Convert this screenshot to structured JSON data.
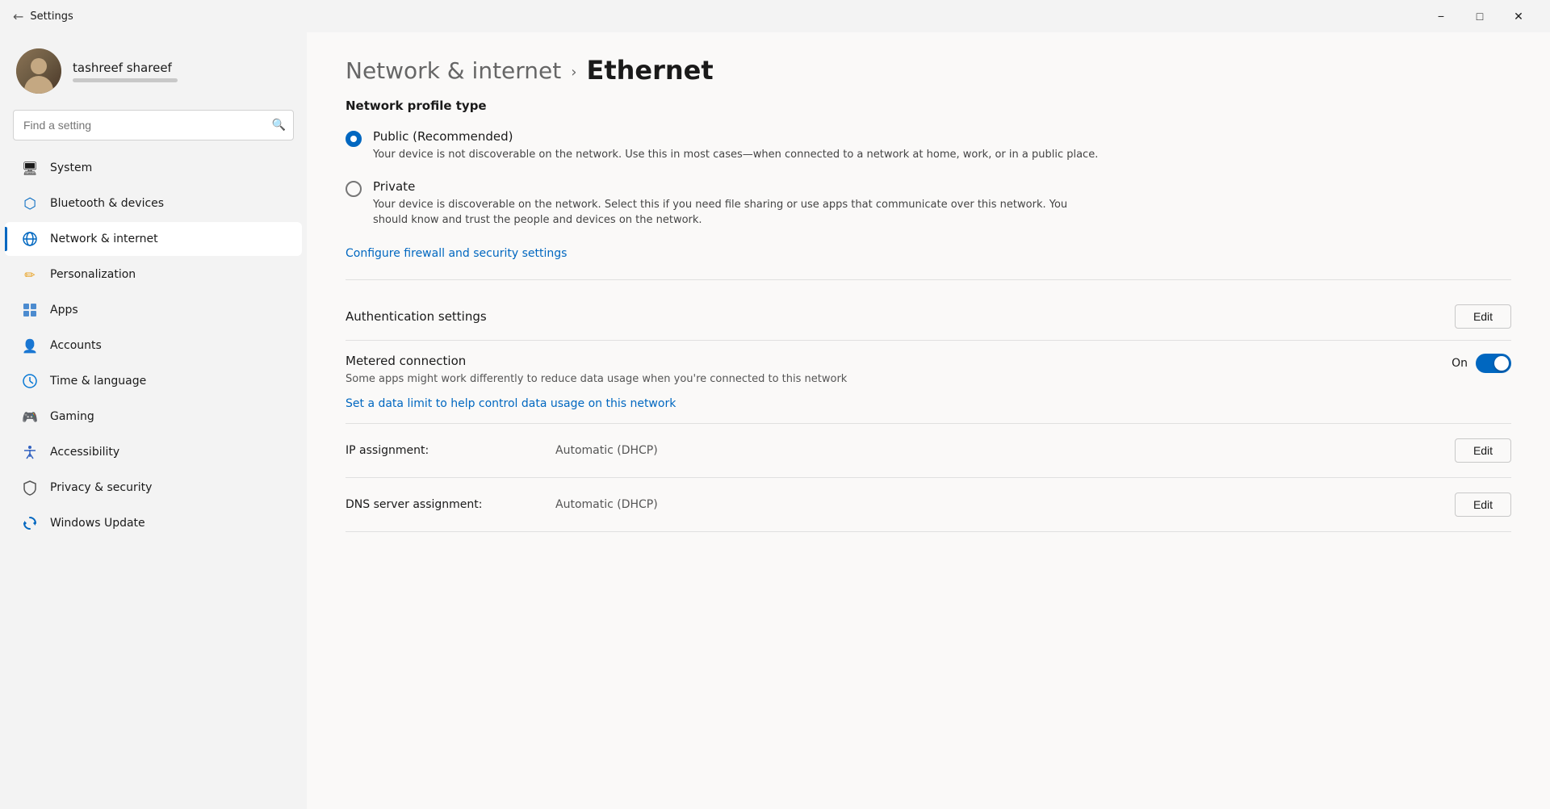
{
  "window": {
    "title": "Settings",
    "minimize_label": "−",
    "maximize_label": "□",
    "close_label": "✕"
  },
  "sidebar": {
    "user": {
      "name": "tashreef shareef"
    },
    "search_placeholder": "Find a setting",
    "items": [
      {
        "id": "system",
        "label": "System",
        "icon": "🖥",
        "active": false
      },
      {
        "id": "bluetooth",
        "label": "Bluetooth & devices",
        "icon": "⬟",
        "active": false
      },
      {
        "id": "network",
        "label": "Network & internet",
        "icon": "🌐",
        "active": true
      },
      {
        "id": "personalization",
        "label": "Personalization",
        "icon": "✏",
        "active": false
      },
      {
        "id": "apps",
        "label": "Apps",
        "icon": "📦",
        "active": false
      },
      {
        "id": "accounts",
        "label": "Accounts",
        "icon": "👤",
        "active": false
      },
      {
        "id": "time",
        "label": "Time & language",
        "icon": "🌍",
        "active": false
      },
      {
        "id": "gaming",
        "label": "Gaming",
        "icon": "🎮",
        "active": false
      },
      {
        "id": "accessibility",
        "label": "Accessibility",
        "icon": "♿",
        "active": false
      },
      {
        "id": "privacy",
        "label": "Privacy & security",
        "icon": "🛡",
        "active": false
      },
      {
        "id": "update",
        "label": "Windows Update",
        "icon": "🔄",
        "active": false
      }
    ]
  },
  "breadcrumb": {
    "parent": "Network & internet",
    "separator": "›",
    "current": "Ethernet"
  },
  "content": {
    "profile_section_title": "Network profile type",
    "public_label": "Public (Recommended)",
    "public_desc": "Your device is not discoverable on the network. Use this in most cases—when connected to a network at home, work, or in a public place.",
    "private_label": "Private",
    "private_desc": "Your device is discoverable on the network. Select this if you need file sharing or use apps that communicate over this network. You should know and trust the people and devices on the network.",
    "firewall_link": "Configure firewall and security settings",
    "auth_section_label": "Authentication settings",
    "auth_edit_label": "Edit",
    "metered_label": "Metered connection",
    "metered_desc": "Some apps might work differently to reduce data usage when you're connected to this network",
    "metered_toggle_label": "On",
    "metered_link": "Set a data limit to help control data usage on this network",
    "ip_assignment_label": "IP assignment:",
    "ip_assignment_value": "Automatic (DHCP)",
    "ip_assignment_edit": "Edit",
    "dns_label": "DNS server assignment:",
    "dns_value": "Automatic (DHCP)",
    "dns_edit": "Edit"
  }
}
